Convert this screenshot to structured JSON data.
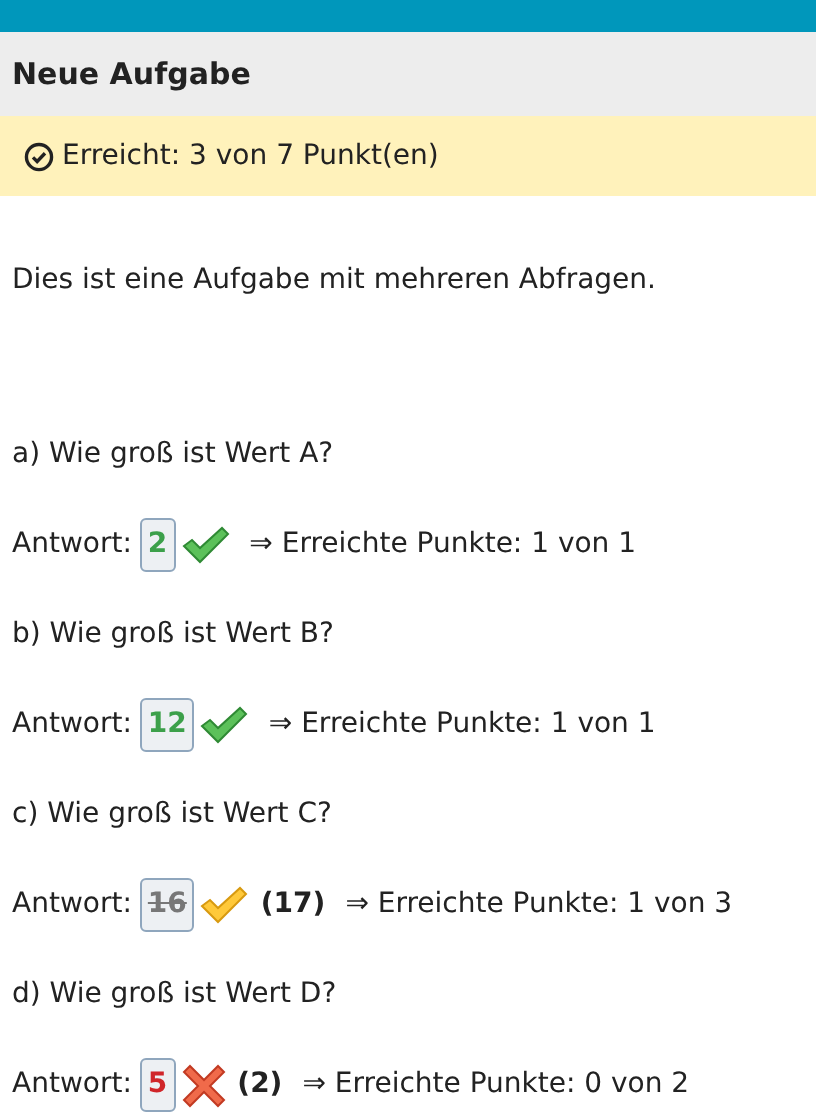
{
  "title": "Neue Aufgabe",
  "score": "Erreicht: 3 von 7 Punkt(en)",
  "intro": "Dies ist eine Aufgabe mit mehreren Abfragen.",
  "questions": [
    {
      "question": "a) Wie groß ist Wert A?",
      "label": "Antwort:",
      "answer": "2",
      "kind": "correct",
      "result": "⇒ Erreichte Punkte: 1 von 1"
    },
    {
      "question": "b) Wie groß ist Wert B?",
      "label": "Antwort:",
      "answer": "12",
      "kind": "correct",
      "result": "⇒ Erreichte Punkte: 1 von 1"
    },
    {
      "question": "c) Wie groß ist Wert C?",
      "label": "Antwort:",
      "answer": "16",
      "kind": "partial",
      "solution": "(17)",
      "result": "⇒ Erreichte Punkte: 1 von 3"
    },
    {
      "question": "d) Wie groß ist Wert D?",
      "label": "Antwort:",
      "answer": "5",
      "kind": "wrong",
      "solution": "(2)",
      "result": "⇒ Erreichte Punkte: 0 von 2"
    }
  ]
}
